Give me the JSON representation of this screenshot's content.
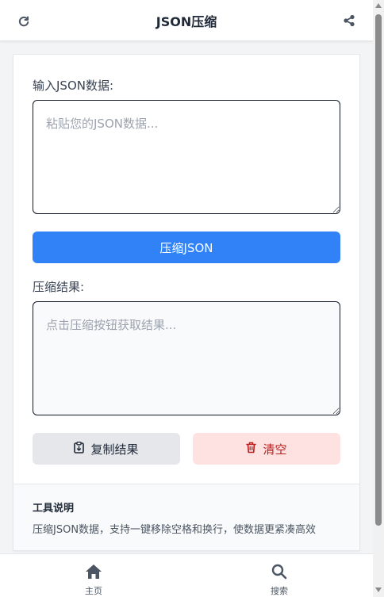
{
  "header": {
    "title": "JSON压缩",
    "refresh_icon": "refresh-icon",
    "share_icon": "share-icon"
  },
  "input": {
    "label": "输入JSON数据:",
    "placeholder": "粘贴您的JSON数据...",
    "value": ""
  },
  "compress_button": {
    "label": "压缩JSON"
  },
  "output": {
    "label": "压缩结果:",
    "placeholder": "点击压缩按钮获取结果...",
    "value": ""
  },
  "actions": {
    "copy_label": "复制结果",
    "copy_icon": "clipboard-icon",
    "clear_label": "清空",
    "clear_icon": "trash-icon"
  },
  "info": {
    "heading": "工具说明",
    "description": "压缩JSON数据，支持一键移除空格和换行，使数据更紧凑高效"
  },
  "bottom_nav": {
    "items": [
      {
        "label": "主页",
        "icon": "home-icon"
      },
      {
        "label": "搜索",
        "icon": "search-icon"
      }
    ]
  },
  "colors": {
    "primary": "#3182f6",
    "danger_bg": "#fee2e2",
    "danger_text": "#b91c1c",
    "secondary_bg": "#e5e7eb"
  }
}
